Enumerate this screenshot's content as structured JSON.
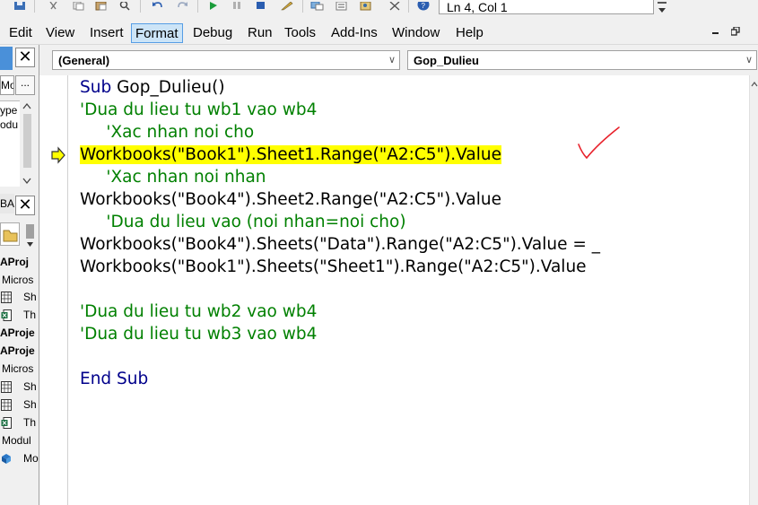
{
  "toolbar": {
    "icons": [
      "save-icon",
      "cut-icon",
      "copy-icon",
      "paste-icon",
      "find-icon",
      "undo-icon",
      "redo-icon",
      "run-icon",
      "break-icon",
      "reset-icon",
      "design-mode-icon",
      "project-explorer-icon",
      "properties-icon",
      "object-browser-icon",
      "toolbox-icon",
      "help-icon"
    ],
    "status": "Ln 4, Col 1"
  },
  "menu": {
    "items": [
      "Edit",
      "View",
      "Insert",
      "Format",
      "Debug",
      "Run",
      "Tools",
      "Add-Ins",
      "Window",
      "Help"
    ],
    "active": "Format"
  },
  "left_panel": {
    "top_label": "Mo",
    "browse_button": "...",
    "properties_labels": [
      "ype",
      "odu"
    ],
    "tab_label": "BA",
    "tree": [
      {
        "text": "AProj",
        "bold": true,
        "icon": "project-icon"
      },
      {
        "text": "Micros",
        "bold": false,
        "icon": "folder-icon"
      },
      {
        "text": "Sh",
        "bold": false,
        "icon": "sheet-icon"
      },
      {
        "text": "Th",
        "bold": false,
        "icon": "workbook-icon"
      },
      {
        "text": "AProje",
        "bold": true,
        "icon": "project-icon"
      },
      {
        "text": "AProje",
        "bold": true,
        "icon": "project-icon"
      },
      {
        "text": "Micros",
        "bold": false,
        "icon": "folder-icon"
      },
      {
        "text": "Sh",
        "bold": false,
        "icon": "sheet-icon"
      },
      {
        "text": "Sh",
        "bold": false,
        "icon": "sheet-icon"
      },
      {
        "text": "Th",
        "bold": false,
        "icon": "workbook-icon"
      },
      {
        "text": "Modul",
        "bold": false,
        "icon": "folder-icon"
      },
      {
        "text": "Mo",
        "bold": false,
        "icon": "module-icon"
      }
    ]
  },
  "code_window": {
    "object_combo": "(General)",
    "procedure_combo": "Gop_Dulieu",
    "current_line_marker": "arrow-right",
    "lines": [
      [
        {
          "t": "Sub",
          "c": "kw"
        },
        {
          "t": " Gop_Dulieu()",
          "c": "plain"
        }
      ],
      [
        {
          "t": "'Dua du lieu tu wb1 vao wb4",
          "c": "cm"
        }
      ],
      [
        {
          "t": "     'Xac nhan noi cho",
          "c": "cm"
        }
      ],
      [
        {
          "t": "Workbooks(\"Book1\").Sheet1.Range(\"A2:C5\").Value",
          "c": "plain",
          "hl": true
        }
      ],
      [
        {
          "t": "     'Xac nhan noi nhan",
          "c": "cm"
        }
      ],
      [
        {
          "t": "Workbooks(\"Book4\").Sheet2.Range(\"A2:C5\").Value",
          "c": "plain"
        }
      ],
      [
        {
          "t": "     'Dua du lieu vao (noi nhan=noi cho)",
          "c": "cm"
        }
      ],
      [
        {
          "t": "Workbooks(\"Book4\").Sheets(\"Data\").Range(\"A2:C5\").Value = _",
          "c": "plain"
        }
      ],
      [
        {
          "t": "Workbooks(\"Book1\").Sheets(\"Sheet1\").Range(\"A2:C5\").Value",
          "c": "plain"
        }
      ],
      [],
      [
        {
          "t": "'Dua du lieu tu wb2 vao wb4",
          "c": "cm"
        }
      ],
      [
        {
          "t": "'Dua du lieu tu wb3 vao wb4",
          "c": "cm"
        }
      ],
      [],
      [
        {
          "t": "End Sub",
          "c": "kw"
        }
      ]
    ]
  },
  "colors": {
    "keyword": "#00008b",
    "comment": "#008000",
    "highlight": "#ffff00",
    "checkmark": "#e8202a"
  }
}
